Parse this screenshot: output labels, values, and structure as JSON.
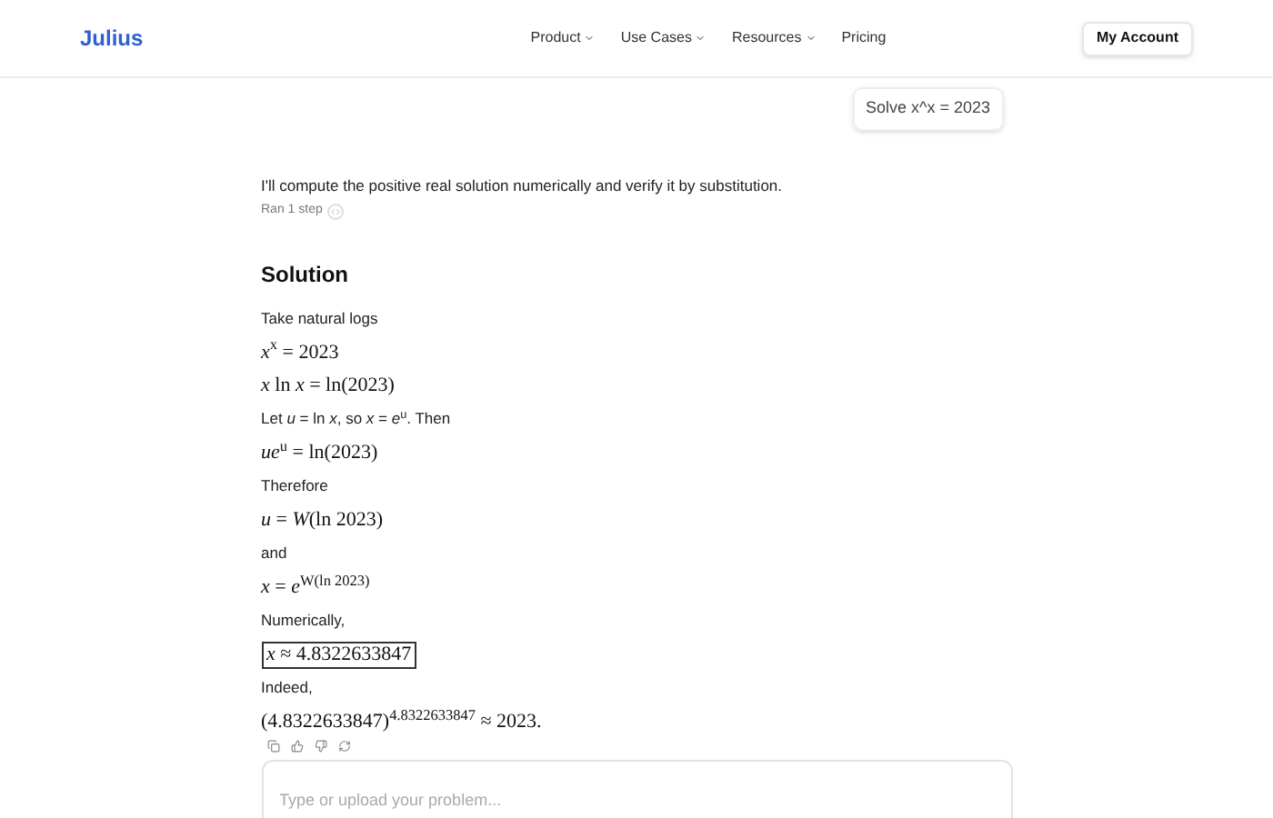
{
  "header": {
    "logo": "Julius",
    "nav": [
      {
        "label": "Product",
        "dropdown": true
      },
      {
        "label": "Use Cases",
        "dropdown": true
      },
      {
        "label": "Resources",
        "dropdown": true
      },
      {
        "label": "Pricing",
        "dropdown": false
      }
    ],
    "account_button": "My Account"
  },
  "user_message": "Solve x^x = 2023",
  "reply": {
    "intro": "I'll compute the positive real solution numerically and verify it by substitution.",
    "steps": "Ran 1 step",
    "blocks": [
      {
        "kind": "heading",
        "text": "Solution"
      },
      {
        "kind": "text",
        "text": "Take natural logs"
      },
      {
        "kind": "math",
        "text": "*x*$^{x}$ = 2023"
      },
      {
        "kind": "math",
        "text": "*x* ln *x* = ln(2023)"
      },
      {
        "kind": "text",
        "text": "Let *u* = ln *x*, so *x* = *e*$^{u}$. Then"
      },
      {
        "kind": "math",
        "text": "*ue*$^{u}$ = ln(2023)"
      },
      {
        "kind": "text",
        "text": "Therefore"
      },
      {
        "kind": "math",
        "text": "*u* = *W*(ln 2023)"
      },
      {
        "kind": "text",
        "text": "and"
      },
      {
        "kind": "math",
        "text": "*x* = *e*$^{W(ln 2023)}$"
      },
      {
        "kind": "text",
        "text": "Numerically,"
      },
      {
        "kind": "boxed",
        "text": "*x* ≈ 4.8322633847"
      },
      {
        "kind": "text",
        "text": "Indeed,"
      },
      {
        "kind": "math",
        "text": "(4.8322633847)$^{4.8322633847}$ ≈ 2023."
      }
    ]
  },
  "input": {
    "placeholder": "Type or upload your problem..."
  }
}
